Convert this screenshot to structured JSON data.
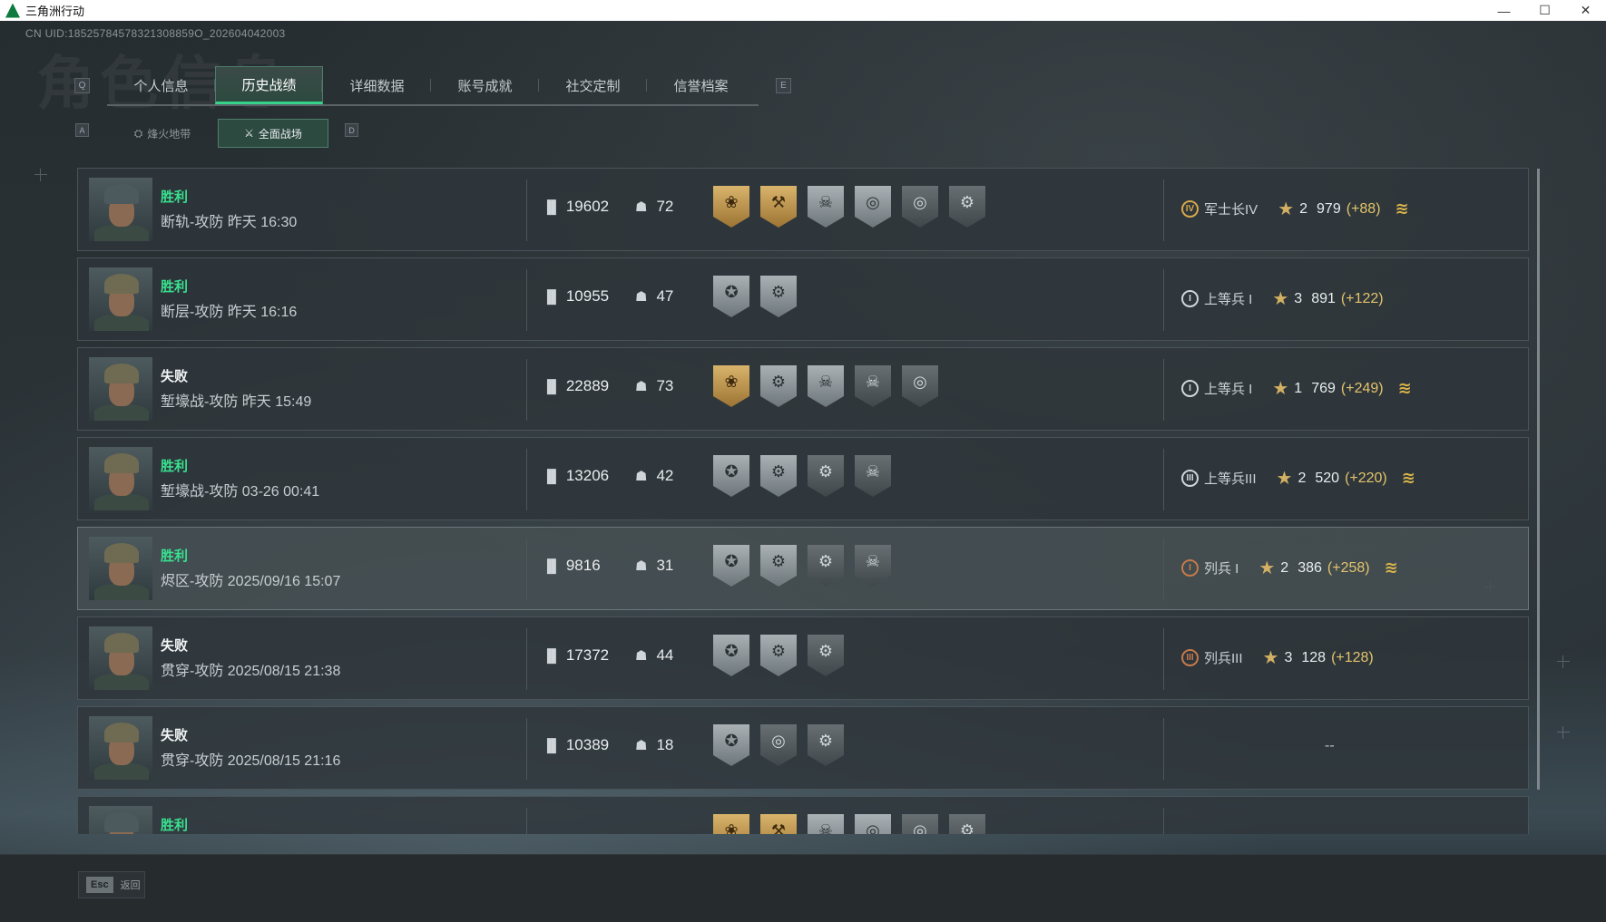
{
  "window": {
    "title": "三角洲行动",
    "controls": [
      "—",
      "☐",
      "✕"
    ]
  },
  "header": {
    "uid": "CN UID:18525784578321308859O_202604042003",
    "bg_title": "角色信息"
  },
  "tabs": {
    "prev_key": "Q",
    "next_key": "E",
    "items": [
      {
        "label": "个人信息"
      },
      {
        "label": "历史战绩"
      },
      {
        "label": "详细数据"
      },
      {
        "label": "账号成就"
      },
      {
        "label": "社交定制"
      },
      {
        "label": "信誉档案"
      }
    ],
    "active_index": 1
  },
  "subtabs": {
    "prev_key": "A",
    "next_key": "D",
    "items": [
      {
        "label": "烽火地带",
        "icon": "fire-zone-icon"
      },
      {
        "label": "全面战场",
        "icon": "battlefield-icon"
      }
    ],
    "active_index": 1
  },
  "matches": [
    {
      "result": "胜利",
      "outcome": "win",
      "map": "断轨-攻防 昨天 16:30",
      "score": "19602",
      "kills": "72",
      "badges": [
        "gold",
        "gold",
        "silver",
        "silver",
        "dark",
        "dark"
      ],
      "rank_icon": "IV",
      "rank_tier": "gold",
      "rank": "军士长IV",
      "stars": "2",
      "points": "979",
      "delta": "(+88)",
      "promoted": true,
      "avatar": "helmet-cap"
    },
    {
      "result": "胜利",
      "outcome": "win",
      "map": "断层-攻防 昨天 16:16",
      "score": "10955",
      "kills": "47",
      "badges": [
        "silver",
        "silver"
      ],
      "rank_icon": "I",
      "rank_tier": "silver",
      "rank": "上等兵 I",
      "stars": "3",
      "points": "891",
      "delta": "(+122)",
      "promoted": false,
      "avatar": "helmet-spikes"
    },
    {
      "result": "失败",
      "outcome": "lose",
      "map": "堑壕战-攻防 昨天 15:49",
      "score": "22889",
      "kills": "73",
      "badges": [
        "gold",
        "silver",
        "silver",
        "dark",
        "dark"
      ],
      "rank_icon": "I",
      "rank_tier": "silver",
      "rank": "上等兵 I",
      "stars": "1",
      "points": "769",
      "delta": "(+249)",
      "promoted": true,
      "avatar": "helmet-spikes"
    },
    {
      "result": "胜利",
      "outcome": "win",
      "map": "堑壕战-攻防 03-26 00:41",
      "score": "13206",
      "kills": "42",
      "badges": [
        "silver",
        "silver",
        "dark",
        "dark"
      ],
      "rank_icon": "III",
      "rank_tier": "silver",
      "rank": "上等兵III",
      "stars": "2",
      "points": "520",
      "delta": "(+220)",
      "promoted": true,
      "avatar": "helmet-spikes"
    },
    {
      "result": "胜利",
      "outcome": "win",
      "map": "烬区-攻防 2025/09/16 15:07",
      "score": "9816",
      "kills": "31",
      "badges": [
        "silver",
        "silver",
        "dark",
        "dark"
      ],
      "rank_icon": "I",
      "rank_tier": "bronze",
      "rank": "列兵 I",
      "stars": "2",
      "points": "386",
      "delta": "(+258)",
      "promoted": true,
      "avatar": "helmet-spikes"
    },
    {
      "result": "失败",
      "outcome": "lose",
      "map": "贯穿-攻防 2025/08/15 21:38",
      "score": "17372",
      "kills": "44",
      "badges": [
        "silver",
        "silver",
        "dark"
      ],
      "rank_icon": "III",
      "rank_tier": "bronze",
      "rank": "列兵III",
      "stars": "3",
      "points": "128",
      "delta": "(+128)",
      "promoted": false,
      "avatar": "helmet-spikes"
    },
    {
      "result": "失败",
      "outcome": "lose",
      "map": "贯穿-攻防 2025/08/15 21:16",
      "score": "10389",
      "kills": "18",
      "badges": [
        "silver",
        "dark",
        "dark"
      ],
      "rank_icon": "",
      "rank_tier": "",
      "rank": "",
      "stars": "",
      "points": "",
      "delta": "",
      "promoted": false,
      "no_rank": "--",
      "avatar": "helmet-spikes"
    },
    {
      "result": "胜利",
      "outcome": "win",
      "map": "",
      "score": "",
      "kills": "",
      "badges": [
        "gold",
        "gold",
        "silver",
        "silver",
        "dark",
        "dark"
      ],
      "rank_icon": "",
      "rank_tier": "",
      "rank": "",
      "stars": "",
      "points": "",
      "delta": "",
      "promoted": false,
      "avatar": "helmet-cap"
    }
  ],
  "footer": {
    "esc_key": "Esc",
    "back_label": "返回"
  },
  "colors": {
    "accent_green": "#35d48a",
    "win_green": "#39e08f",
    "gold": "#d9b46b",
    "delta_gold": "#e3c46b"
  }
}
